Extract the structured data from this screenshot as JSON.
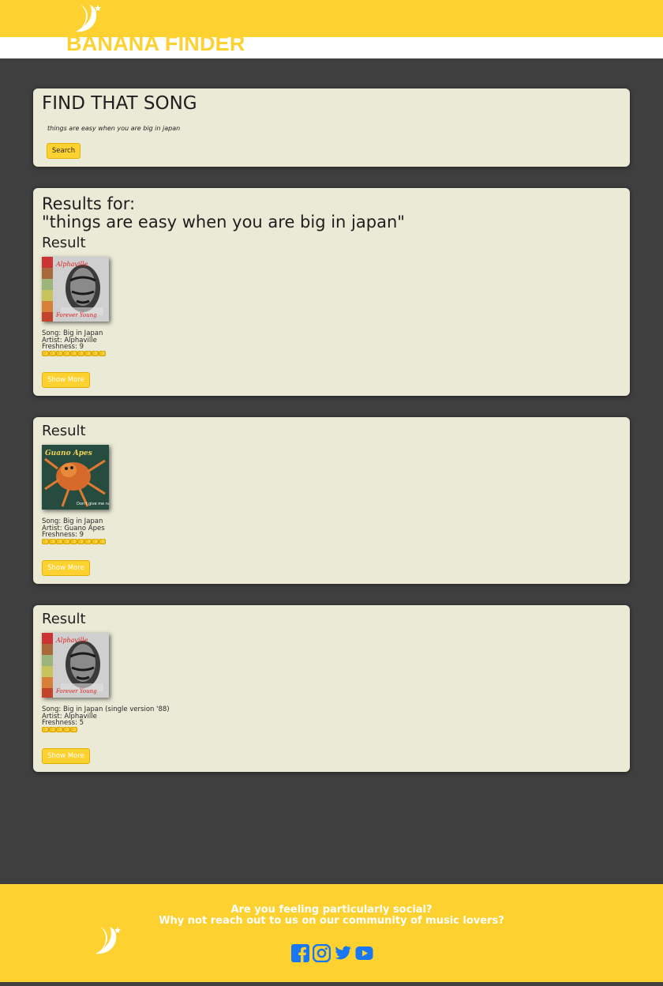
{
  "header": {
    "brand": "BANANA FINDER",
    "logo_icon": "banana-moon-icon"
  },
  "search": {
    "title": "FIND THAT SONG",
    "input_value": "things are easy when you are big in japan",
    "button_label": "Search"
  },
  "results": {
    "heading_line1": "Results for:",
    "heading_line2": "\"things are easy when you are big in japan\"",
    "items": [
      {
        "label": "Result",
        "song": "Song: Big in Japan",
        "artist": "Artist: Alphaville",
        "freshness": "Freshness: 9",
        "freshness_value": 9,
        "cover": "alphaville-cover",
        "show_more": "Show More"
      },
      {
        "label": "Result",
        "song": "Song: Big in Japan",
        "artist": "Artist: Guano Apes",
        "freshness": "Freshness: 9",
        "freshness_value": 9,
        "cover": "guano-apes-cover",
        "show_more": "Show More"
      },
      {
        "label": "Result",
        "song": "Song: Big in Japan (single version '88)",
        "artist": "Artist: Alphaville",
        "freshness": "Freshness: 5",
        "freshness_value": 5,
        "cover": "alphaville-cover",
        "show_more": "Show More"
      }
    ]
  },
  "footer": {
    "line1": "Are you feeling particularly social?",
    "line2": "Why not reach out to us on our community of music lovers?",
    "socials": [
      "facebook-icon",
      "instagram-icon",
      "twitter-icon",
      "youtube-icon"
    ]
  },
  "colors": {
    "accent": "#fdd12f",
    "background": "#3f3f3f",
    "card": "#eaead6",
    "social_blue": "#1877f2"
  }
}
